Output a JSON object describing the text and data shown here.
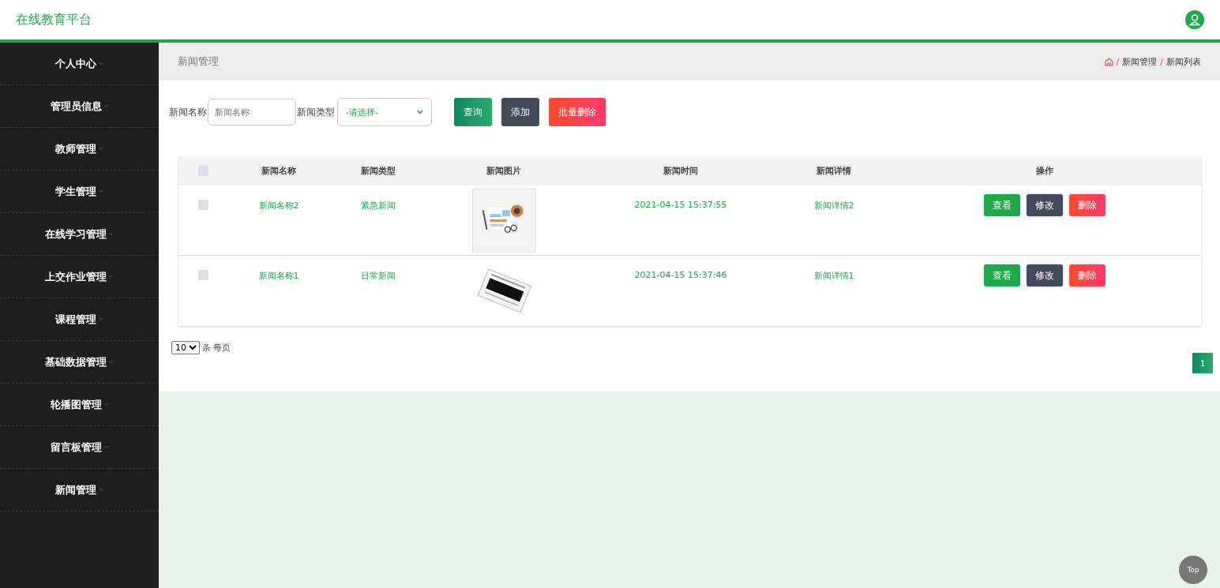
{
  "header": {
    "title": "在线教育平台"
  },
  "sidebar": {
    "items": [
      {
        "label": "个人中心"
      },
      {
        "label": "管理员信息"
      },
      {
        "label": "教师管理"
      },
      {
        "label": "学生管理"
      },
      {
        "label": "在线学习管理"
      },
      {
        "label": "上交作业管理"
      },
      {
        "label": "课程管理"
      },
      {
        "label": "基础数据管理"
      },
      {
        "label": "轮播图管理"
      },
      {
        "label": "留言板管理"
      },
      {
        "label": "新闻管理"
      }
    ]
  },
  "page_title": "新闻管理",
  "breadcrumb": [
    "新闻管理",
    "新闻列表"
  ],
  "breadcrumb_separator": "/",
  "search": {
    "name_label": "新闻名称",
    "name_placeholder": "新闻名称",
    "type_label": "新闻类型",
    "type_value": "-请选择-",
    "buttons": [
      {
        "label": "查询",
        "kind": "query"
      },
      {
        "label": "添加",
        "kind": "add"
      },
      {
        "label": "批量删除",
        "kind": "delete"
      }
    ]
  },
  "table": {
    "select_all_checked": false,
    "columns": [
      "新闻名称",
      "新闻类型",
      "新闻图片",
      "新闻时间",
      "新闻详情",
      "操作"
    ],
    "rows": [
      {
        "checked": false,
        "name": "新闻名称2",
        "type": "紧急新闻",
        "time": "2021-04-15 15:37:55",
        "detail": "新闻详情2",
        "actions": [
          {
            "label": "查看",
            "kind": "view"
          },
          {
            "label": "修改",
            "kind": "edit"
          },
          {
            "label": "删除",
            "kind": "delete"
          }
        ]
      },
      {
        "checked": false,
        "name": "新闻名称1",
        "type": "日常新闻",
        "time": "2021-04-15 15:37:46",
        "detail": "新闻详情1",
        "actions": [
          {
            "label": "查看",
            "kind": "view"
          },
          {
            "label": "修改",
            "kind": "edit"
          },
          {
            "label": "删除",
            "kind": "delete"
          }
        ]
      }
    ]
  },
  "pagination": {
    "page_size": "10",
    "per_page_label": "条 每页",
    "pages": [
      {
        "label": "1",
        "selected": true
      }
    ]
  },
  "top_button": "Top"
}
